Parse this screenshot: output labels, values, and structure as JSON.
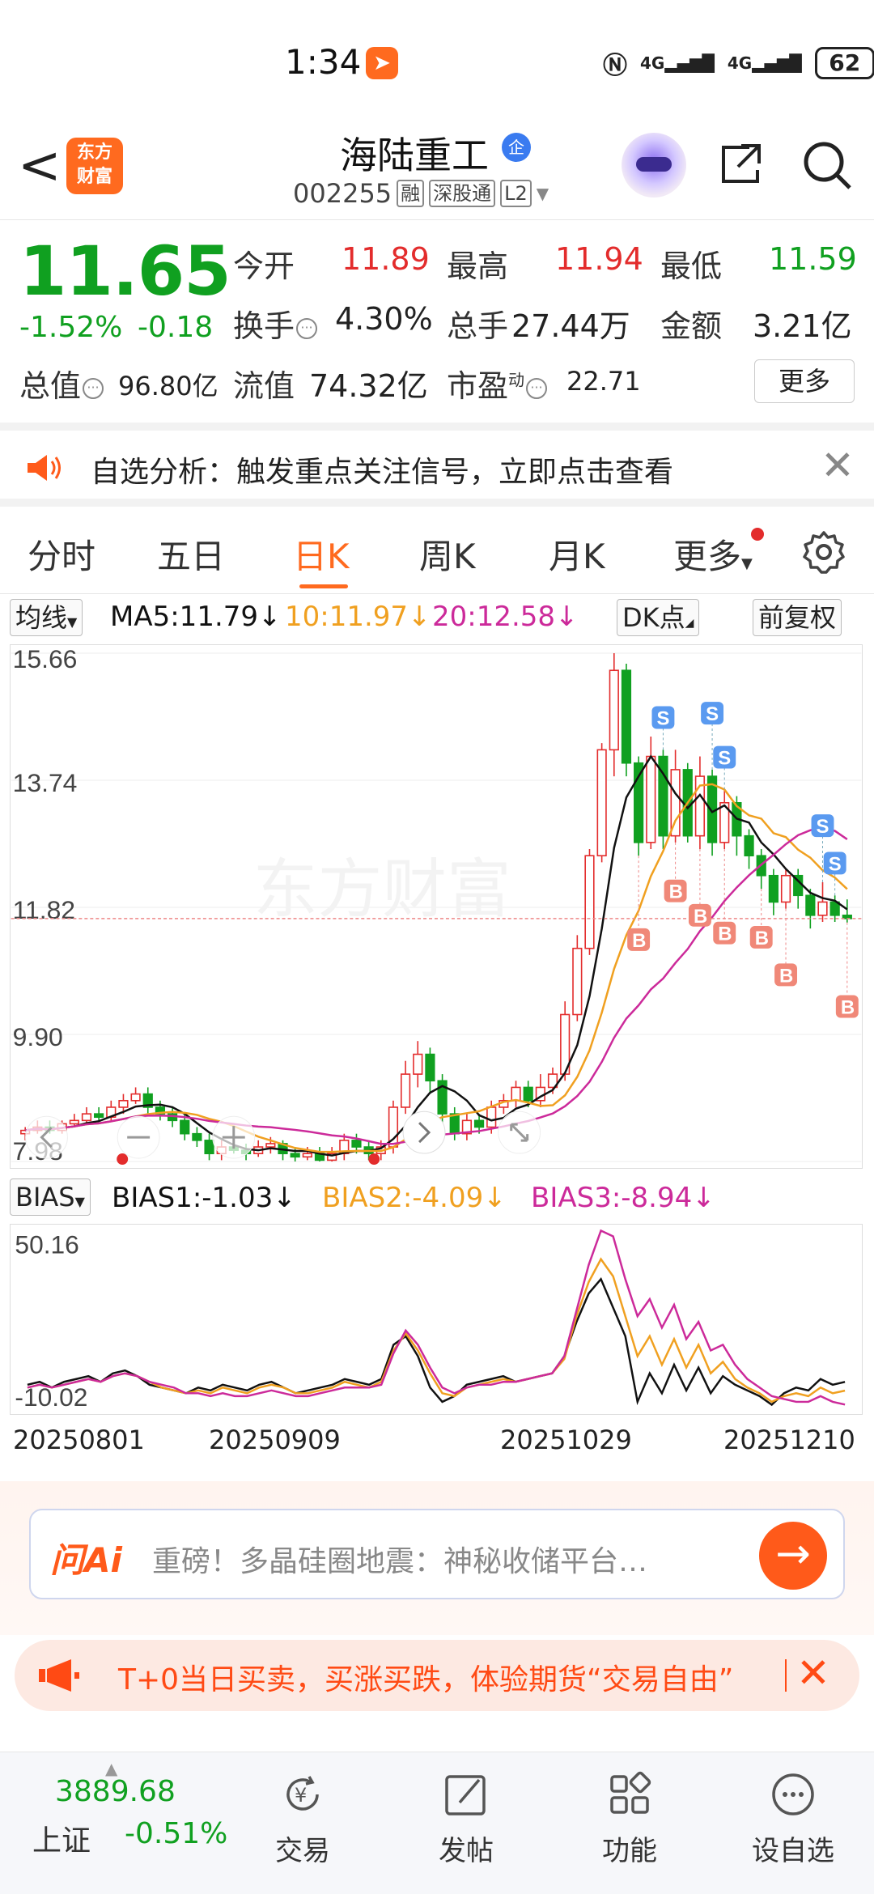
{
  "status_bar": {
    "time": "1:34",
    "signal1": "4G",
    "signal2": "4G",
    "battery": "62"
  },
  "header": {
    "back": "<",
    "logo": "东方财富",
    "stock_name": "海陆重工",
    "ent_badge": "企",
    "code": "002255",
    "tags": [
      "融",
      "深股通",
      "L2"
    ]
  },
  "quote": {
    "price": "11.65",
    "change_pct": "-1.52%",
    "change_abs": "-0.18",
    "open_label": "今开",
    "open": "11.89",
    "high_label": "最高",
    "high": "11.94",
    "low_label": "最低",
    "low": "11.59",
    "turnover_label": "换手",
    "turnover": "4.30%",
    "volume_label": "总手",
    "volume": "27.44万",
    "amount_label": "金额",
    "amount": "3.21亿",
    "mktcap_label": "总值",
    "mktcap": "96.80亿",
    "float_label": "流值",
    "float": "74.32亿",
    "pe_label": "市盈",
    "pe_sup": "动",
    "pe": "22.71",
    "more": "更多"
  },
  "notice": {
    "text": "自选分析：触发重点关注信号，立即点击查看"
  },
  "tabs": [
    "分时",
    "五日",
    "日K",
    "周K",
    "月K",
    "更多"
  ],
  "active_tab": "日K",
  "ma_row": {
    "selector": "均线",
    "ma5": "MA5:11.79↓",
    "ma10": "10:11.97↓",
    "ma20": "20:12.58↓",
    "dk": "DK点",
    "adjust": "前复权"
  },
  "colors": {
    "up": "#e32c2c",
    "down": "#10a020",
    "ma5": "#111111",
    "ma10": "#f0a020",
    "ma20": "#cc2a9a",
    "accent": "#ff6a1f"
  },
  "chart_data": [
    {
      "type": "candlestick",
      "price_ticks": [
        "15.66",
        "13.74",
        "11.82",
        "9.90",
        "7.98"
      ],
      "ylim": [
        7.98,
        15.66
      ],
      "current_price": 11.65,
      "signals": [
        "S",
        "S",
        "S",
        "S",
        "S",
        "B",
        "B",
        "B",
        "B",
        "B",
        "B",
        "B"
      ],
      "candles": [
        [
          8.4,
          8.45,
          8.3,
          8.5
        ],
        [
          8.45,
          8.5,
          8.4,
          8.6
        ],
        [
          8.5,
          8.45,
          8.4,
          8.6
        ],
        [
          8.45,
          8.55,
          8.4,
          8.6
        ],
        [
          8.55,
          8.6,
          8.5,
          8.7
        ],
        [
          8.6,
          8.7,
          8.55,
          8.8
        ],
        [
          8.7,
          8.65,
          8.6,
          8.8
        ],
        [
          8.65,
          8.8,
          8.6,
          8.9
        ],
        [
          8.8,
          8.9,
          8.7,
          9.0
        ],
        [
          8.9,
          9.0,
          8.85,
          9.1
        ],
        [
          9.0,
          8.8,
          8.7,
          9.1
        ],
        [
          8.8,
          8.7,
          8.6,
          8.9
        ],
        [
          8.7,
          8.6,
          8.5,
          8.8
        ],
        [
          8.6,
          8.4,
          8.3,
          8.7
        ],
        [
          8.4,
          8.3,
          8.2,
          8.5
        ],
        [
          8.3,
          8.1,
          8.0,
          8.4
        ],
        [
          8.1,
          8.2,
          8.0,
          8.3
        ],
        [
          8.2,
          8.15,
          8.1,
          8.3
        ],
        [
          8.15,
          8.1,
          8.0,
          8.25
        ],
        [
          8.1,
          8.2,
          8.05,
          8.3
        ],
        [
          8.2,
          8.25,
          8.1,
          8.35
        ],
        [
          8.25,
          8.1,
          8.0,
          8.3
        ],
        [
          8.1,
          8.05,
          7.98,
          8.2
        ],
        [
          8.05,
          8.1,
          8.0,
          8.2
        ],
        [
          8.1,
          8.0,
          7.98,
          8.2
        ],
        [
          8.0,
          8.1,
          7.98,
          8.2
        ],
        [
          8.1,
          8.3,
          8.0,
          8.4
        ],
        [
          8.3,
          8.2,
          8.1,
          8.4
        ],
        [
          8.2,
          8.1,
          8.0,
          8.3
        ],
        [
          8.1,
          8.2,
          8.0,
          8.3
        ],
        [
          8.2,
          8.8,
          8.1,
          8.9
        ],
        [
          8.8,
          9.3,
          8.7,
          9.5
        ],
        [
          9.3,
          9.6,
          9.1,
          9.8
        ],
        [
          9.6,
          9.2,
          9.0,
          9.7
        ],
        [
          9.2,
          8.7,
          8.5,
          9.3
        ],
        [
          8.7,
          8.4,
          8.3,
          8.8
        ],
        [
          8.4,
          8.6,
          8.3,
          8.7
        ],
        [
          8.6,
          8.5,
          8.4,
          8.7
        ],
        [
          8.5,
          8.8,
          8.4,
          8.9
        ],
        [
          8.8,
          8.9,
          8.7,
          9.0
        ],
        [
          8.9,
          9.1,
          8.8,
          9.2
        ],
        [
          9.1,
          8.9,
          8.8,
          9.2
        ],
        [
          8.9,
          9.1,
          8.8,
          9.3
        ],
        [
          9.1,
          9.3,
          9.0,
          9.4
        ],
        [
          9.3,
          10.2,
          9.2,
          10.4
        ],
        [
          10.2,
          11.2,
          10.1,
          11.4
        ],
        [
          11.2,
          12.6,
          11.1,
          12.7
        ],
        [
          12.6,
          14.2,
          12.5,
          14.3
        ],
        [
          14.2,
          15.4,
          13.8,
          15.66
        ],
        [
          15.4,
          14.0,
          13.8,
          15.5
        ],
        [
          14.0,
          12.8,
          12.6,
          14.1
        ],
        [
          12.8,
          14.1,
          12.7,
          14.4
        ],
        [
          14.1,
          12.9,
          12.7,
          14.2
        ],
        [
          12.9,
          13.9,
          12.8,
          14.2
        ],
        [
          13.9,
          12.9,
          12.8,
          14.0
        ],
        [
          12.9,
          13.8,
          12.7,
          14.1
        ],
        [
          13.8,
          12.8,
          12.6,
          13.9
        ],
        [
          12.8,
          13.4,
          12.7,
          13.6
        ],
        [
          13.4,
          12.9,
          12.6,
          13.5
        ],
        [
          12.9,
          12.6,
          12.4,
          13.0
        ],
        [
          12.6,
          12.3,
          12.1,
          12.7
        ],
        [
          12.3,
          11.9,
          11.7,
          12.4
        ],
        [
          11.9,
          12.3,
          11.8,
          12.4
        ],
        [
          12.3,
          12.0,
          11.8,
          12.4
        ],
        [
          12.0,
          11.7,
          11.5,
          12.1
        ],
        [
          11.7,
          11.9,
          11.6,
          12.2
        ],
        [
          11.9,
          11.7,
          11.6,
          12.0
        ],
        [
          11.7,
          11.65,
          11.59,
          11.94
        ]
      ]
    },
    {
      "type": "line",
      "indicator": "BIAS",
      "ylim": [
        -10.02,
        50.16
      ],
      "y_ticks": [
        "50.16",
        "-10.02"
      ],
      "series": [
        {
          "name": "BIAS1",
          "values": [
            -2,
            -1,
            -3,
            -1,
            0,
            1,
            -1,
            2,
            3,
            1,
            -2,
            -3,
            -4,
            -5,
            -3,
            -4,
            -2,
            -3,
            -4,
            -2,
            -1,
            -3,
            -5,
            -4,
            -3,
            -2,
            0,
            -1,
            -2,
            0,
            12,
            15,
            8,
            -3,
            -8,
            -6,
            -2,
            -1,
            0,
            1,
            -1,
            0,
            1,
            2,
            8,
            20,
            30,
            35,
            25,
            15,
            -8,
            2,
            -5,
            5,
            -4,
            4,
            -5,
            1,
            -2,
            -4,
            -6,
            -9,
            -5,
            -3,
            -4,
            0,
            -2,
            -1.03
          ]
        },
        {
          "name": "BIAS2",
          "values": [
            -3,
            -2,
            -3,
            -2,
            -1,
            0,
            -1,
            1,
            2,
            1,
            -1,
            -3,
            -4,
            -5,
            -4,
            -5,
            -3,
            -4,
            -5,
            -3,
            -2,
            -3,
            -5,
            -5,
            -4,
            -3,
            -1,
            -2,
            -3,
            -1,
            10,
            16,
            10,
            2,
            -5,
            -6,
            -3,
            -2,
            -1,
            0,
            -1,
            0,
            1,
            2,
            7,
            22,
            34,
            42,
            36,
            22,
            8,
            15,
            5,
            14,
            4,
            12,
            2,
            6,
            0,
            -3,
            -5,
            -8,
            -6,
            -5,
            -6,
            -3,
            -5,
            -4.09
          ]
        },
        {
          "name": "BIAS3",
          "values": [
            -3,
            -2,
            -3,
            -2,
            -1,
            0,
            -1,
            1,
            2,
            1,
            -1,
            -2,
            -3,
            -5,
            -5,
            -6,
            -5,
            -6,
            -6,
            -5,
            -4,
            -5,
            -6,
            -6,
            -5,
            -4,
            -3,
            -3,
            -3,
            -2,
            9,
            17,
            12,
            4,
            -3,
            -5,
            -3,
            -2,
            -2,
            -1,
            -1,
            0,
            1,
            2,
            8,
            24,
            40,
            52,
            50,
            35,
            22,
            28,
            18,
            26,
            14,
            20,
            10,
            12,
            5,
            0,
            -3,
            -6,
            -7,
            -8,
            -8,
            -6,
            -8,
            -8.94
          ]
        }
      ]
    }
  ],
  "bias_row": {
    "selector": "BIAS",
    "bias1": "BIAS1:-1.03↓",
    "bias2": "BIAS2:-4.09↓",
    "bias3": "BIAS3:-8.94↓"
  },
  "dates": [
    "20250801",
    "20250909",
    "20251029",
    "20251210"
  ],
  "ai": {
    "logo": "问Ai",
    "text": "重磅！多晶硅圈地震：神秘收储平台…"
  },
  "promo": {
    "text": "T+0当日买卖，买涨买跌，体验期货“交易自由”"
  },
  "bottom_nav": {
    "index_value": "3889.68",
    "index_name": "上证",
    "index_change": "-0.51%",
    "items": [
      "交易",
      "发帖",
      "功能",
      "设自选"
    ]
  }
}
